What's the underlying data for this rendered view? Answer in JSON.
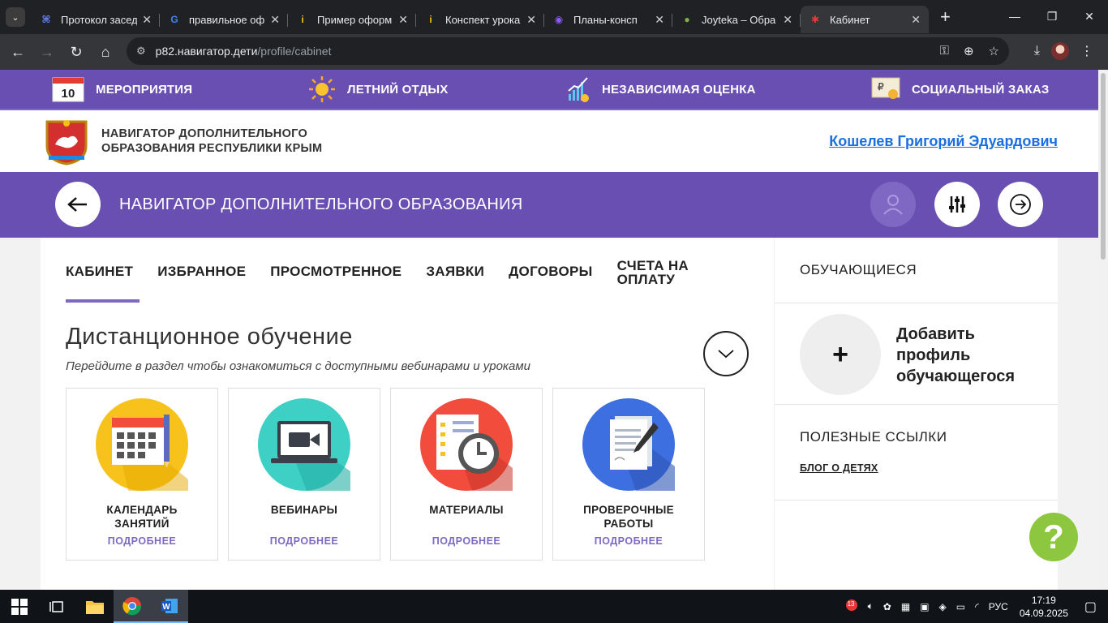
{
  "browser": {
    "tabs": [
      {
        "title": "Протокол заседа",
        "fav_glyph": "⌘",
        "fav_color": "#6b8cff"
      },
      {
        "title": "правильное оф",
        "fav_glyph": "G",
        "fav_color": "#4285f4"
      },
      {
        "title": "Пример оформ",
        "fav_glyph": "i",
        "fav_color": "#f4c20d"
      },
      {
        "title": "Конспект урока",
        "fav_glyph": "i",
        "fav_color": "#f4c20d"
      },
      {
        "title": "Планы-консп",
        "fav_glyph": "◉",
        "fav_color": "#8b5cf6"
      },
      {
        "title": "Joyteka – Обра",
        "fav_glyph": "●",
        "fav_color": "#7cb342"
      },
      {
        "title": "Кабинет",
        "fav_glyph": "✱",
        "fav_color": "#e53935"
      }
    ],
    "url_host": "p82.навигатор.дети",
    "url_path": "/profile/cabinet"
  },
  "topnav": {
    "events": "МЕРОПРИЯТИЯ",
    "calendar_day": "10",
    "summer": "ЛЕТНИЙ ОТДЫХ",
    "assessment": "НЕЗАВИСИМАЯ ОЦЕНКА",
    "social": "СОЦИАЛЬНЫЙ ЗАКАЗ",
    "social_glyph": "₽"
  },
  "header": {
    "logo_line1": "НАВИГАТОР ДОПОЛНИТЕЛЬНОГО",
    "logo_line2": "ОБРАЗОВАНИЯ РЕСПУБЛИКИ КРЫМ",
    "user_name": "Кошелев Григорий Эдуардович"
  },
  "banner": {
    "title": "НАВИГАТОР ДОПОЛНИТЕЛЬНОГО ОБРАЗОВАНИЯ"
  },
  "profile_tabs": [
    "КАБИНЕТ",
    "ИЗБРАННОЕ",
    "ПРОСМОТРЕННОЕ",
    "ЗАЯВКИ",
    "ДОГОВОРЫ"
  ],
  "profile_tab_last": {
    "line1": "СЧЕТА НА",
    "line2": "ОПЛАТУ"
  },
  "section": {
    "title": "Дистанционное обучение",
    "subtitle": "Перейдите в раздел чтобы ознакомиться с доступными вебинарами и уроками"
  },
  "cards": [
    {
      "line1": "КАЛЕНДАРЬ",
      "line2": "ЗАНЯТИЙ",
      "more": "ПОДРОБНЕЕ",
      "color": "#f7c21b"
    },
    {
      "line1": "ВЕБИНАРЫ",
      "line2": "",
      "more": "ПОДРОБНЕЕ",
      "color": "#3ecfc5"
    },
    {
      "line1": "МАТЕРИАЛЫ",
      "line2": "",
      "more": "ПОДРОБНЕЕ",
      "color": "#f24c3d"
    },
    {
      "line1": "ПРОВЕРОЧНЫЕ",
      "line2": "РАБОТЫ",
      "more": "ПОДРОБНЕЕ",
      "color": "#3d6fe0"
    }
  ],
  "sidebar": {
    "students_title": "ОБУЧАЮЩИЕСЯ",
    "add_symbol": "+",
    "add_line1": "Добавить",
    "add_line2": "профиль",
    "add_line3": "обучающегося",
    "links_title": "ПОЛЕЗНЫЕ ССЫЛКИ",
    "blog": "БЛОГ О ДЕТЯХ"
  },
  "help": {
    "symbol": "?"
  },
  "taskbar": {
    "time": "17:19",
    "date": "04.09.2025",
    "lang": "РУС",
    "badge": "13"
  }
}
